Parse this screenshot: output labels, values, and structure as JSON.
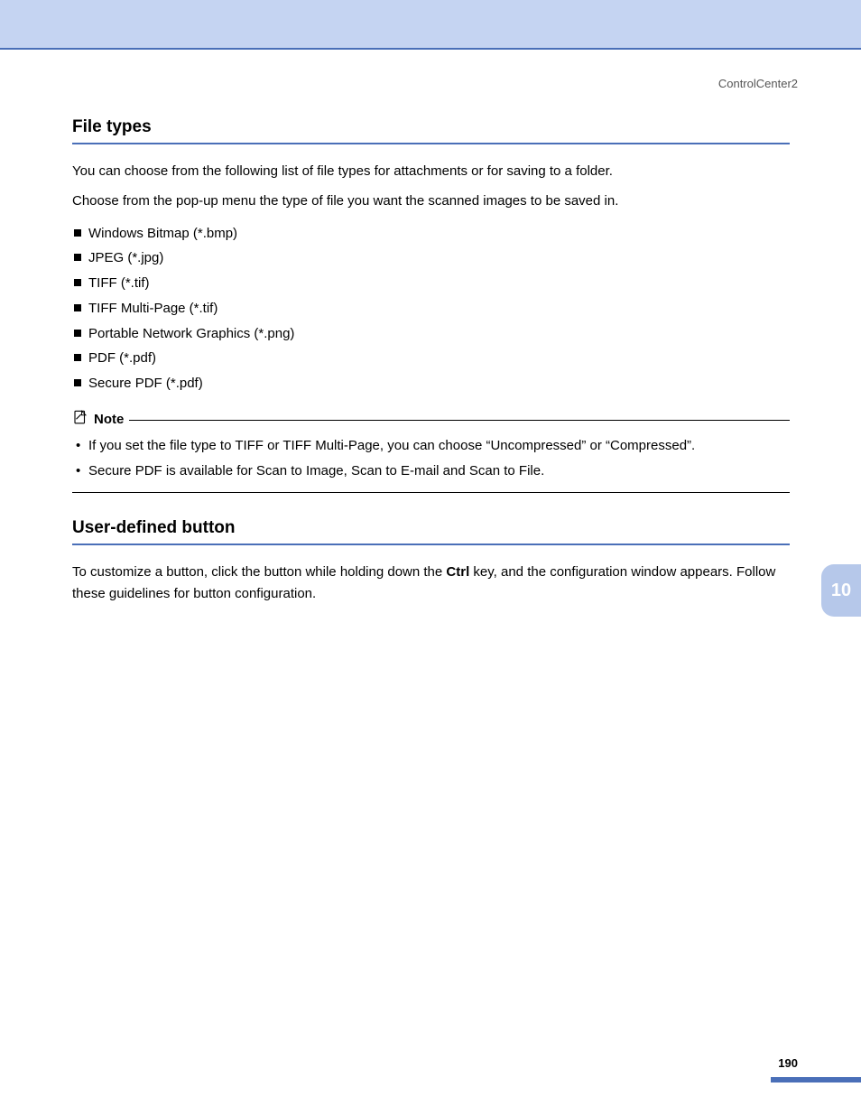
{
  "header": {
    "label": "ControlCenter2"
  },
  "section1": {
    "title": "File types",
    "para1": "You can choose from the following list of file types for attachments or for saving to a folder.",
    "para2": "Choose from the pop-up menu the type of file you want the scanned images to be saved in.",
    "items": [
      "Windows Bitmap (*.bmp)",
      "JPEG (*.jpg)",
      "TIFF (*.tif)",
      "TIFF Multi-Page (*.tif)",
      "Portable Network Graphics (*.png)",
      "PDF (*.pdf)",
      "Secure PDF (*.pdf)"
    ]
  },
  "note": {
    "title": "Note",
    "items": [
      "If you set the file type to TIFF or TIFF Multi-Page, you can choose “Uncompressed” or “Compressed”.",
      "Secure PDF is available for Scan to Image, Scan to E-mail and Scan to File."
    ]
  },
  "section2": {
    "title": "User-defined button",
    "para_pre": "To customize a button, click the button while holding down the ",
    "para_bold": "Ctrl",
    "para_post": " key, and the configuration window appears. Follow these guidelines for button configuration."
  },
  "sidetab": "10",
  "page_number": "190"
}
